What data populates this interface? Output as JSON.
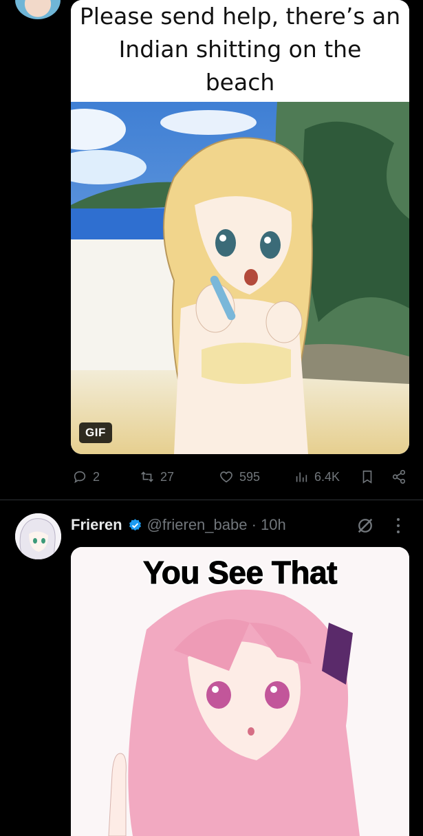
{
  "post1": {
    "caption_lines": [
      "Please send help, there’s an",
      "Indian shitting on the",
      "beach"
    ],
    "gif_badge": "GIF",
    "actions": {
      "replies": "2",
      "reposts": "27",
      "likes": "595",
      "views": "6.4K"
    }
  },
  "post2": {
    "display_name": "Frieren",
    "handle_time": "@frieren_babe · 10h",
    "image_caption": "You See That"
  },
  "colors": {
    "background": "#000000",
    "muted": "#71767b",
    "accent": "#1d9bf0"
  },
  "icons": [
    "reply-icon",
    "repost-icon",
    "like-icon",
    "views-icon",
    "bookmark-icon",
    "share-icon",
    "verified-badge-icon",
    "grok-icon",
    "more-icon"
  ]
}
